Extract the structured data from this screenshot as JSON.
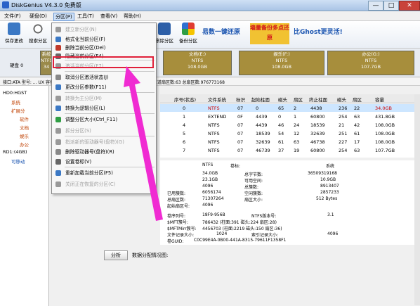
{
  "window": {
    "title": "DiskGenius V4.3.0 免费版",
    "min": "—",
    "max": "□",
    "close": "✕"
  },
  "menu": [
    "文件(F)",
    "硬盘(D)",
    "分区(P)",
    "工具(T)",
    "查看(V)",
    "帮助(H)"
  ],
  "toolbar": {
    "buttons": [
      "保存更改",
      "搜索分区",
      "删除分区",
      "备份分区"
    ],
    "banner1": "易数一键还原",
    "banner2": "墙量备份多点还原",
    "banner3": "比Ghost更灵活!"
  },
  "disk": {
    "label": "硬盘 0",
    "model_label": "型号",
    "partitions": [
      {
        "name": "系统",
        "fs": "NTFS",
        "size": "34",
        "color": "#9a8a4a"
      },
      {
        "name": "文档(E:)",
        "fs": "NTFS",
        "size": "108.0GB",
        "color": "#a78e3c"
      },
      {
        "name": "娱乐(F:)",
        "fs": "NTFS",
        "size": "108.0GB",
        "color": "#a78e3c"
      },
      {
        "name": "办公(G:)",
        "fs": "NTFS",
        "size": "107.7GB",
        "color": "#a78e3c"
      }
    ]
  },
  "infoline": "接口:ATA  型号:  ...  UX  容量:465.8GB(476940MB)  柱面数:60801  磁头数:255  每道扇区数:63  总扇区数:976773168",
  "tree": [
    "HD0:HGST",
    "系统",
    "扩展分",
    "软件",
    "文档",
    "娱乐",
    "办公",
    "RD1:(4GB)",
    "可移动"
  ],
  "context_menu": {
    "items": [
      {
        "label": "建立新分区(N)",
        "disabled": true
      },
      {
        "label": "格式化当前分区(F)",
        "disabled": false
      },
      {
        "label": "删除当前分区(Del)",
        "disabled": false
      },
      {
        "label": "隐藏当前分区(F4)",
        "disabled": false
      },
      {
        "label": "激活当前分区(F7)",
        "disabled": true
      },
      {
        "label": "取消分区激活状态(J)",
        "disabled": false
      },
      {
        "label": "更改分区参数(F11)",
        "disabled": false
      },
      {
        "label": "转换为主分区(M)",
        "disabled": true
      },
      {
        "label": "转换为逻辑分区(L)",
        "disabled": false
      },
      {
        "label": "调整分区大小(Ctrl_F11)",
        "disabled": false
      },
      {
        "label": "拆分分区(S)",
        "disabled": true
      },
      {
        "label": "指派新的驱动器号(盘符)(G)",
        "disabled": true
      },
      {
        "label": "删除驱动器号(盘符)(R)",
        "disabled": false
      },
      {
        "label": "设置卷标(V)",
        "disabled": false
      },
      {
        "label": "重新加载当前分区(F5)",
        "disabled": false
      },
      {
        "label": "关闭正在恢复的分区(C)",
        "disabled": true
      }
    ]
  },
  "table": {
    "headers": [
      "序号(状态)",
      "文件系统",
      "标识",
      "起始柱面",
      "磁头",
      "扇区",
      "终止柱面",
      "磁头",
      "扇区",
      "容量"
    ],
    "rows": [
      [
        "0",
        "NTFS",
        "07",
        "0",
        "65",
        "2",
        "4438",
        "236",
        "22",
        "34.0GB"
      ],
      [
        "1",
        "EXTEND",
        "0F",
        "4439",
        "0",
        "1",
        "60800",
        "254",
        "63",
        "431.8GB"
      ],
      [
        "4",
        "NTFS",
        "07",
        "4439",
        "46",
        "24",
        "18539",
        "21",
        "42",
        "108.0GB"
      ],
      [
        "5",
        "NTFS",
        "07",
        "18539",
        "54",
        "12",
        "32639",
        "251",
        "61",
        "108.0GB"
      ],
      [
        "6",
        "NTFS",
        "07",
        "32639",
        "61",
        "63",
        "46738",
        "227",
        "17",
        "108.0GB"
      ],
      [
        "7",
        "NTFS",
        "07",
        "46739",
        "37",
        "19",
        "60800",
        "254",
        "63",
        "107.7GB"
      ]
    ]
  },
  "detail": {
    "fs_label": "NTFS",
    "vol_label": "卷标:",
    "sys_label": "系统",
    "left_vals": [
      "34.0GB",
      "23.1GB",
      "4096",
      "6056174",
      "71307264",
      "4096"
    ],
    "left_keys": [
      "",
      "",
      "",
      "已用簇数:",
      "总扇区数:",
      "起始扇区号:"
    ],
    "mid_keys": [
      "总字节数:",
      "可用空间:",
      "总簇数:",
      "空闲簇数:",
      "扇区大小:"
    ],
    "right_vals": [
      "36509319168",
      "10.9GB",
      "8913407",
      "2857233",
      "512 Bytes"
    ],
    "serial_key": "卷序列号:",
    "serial_val": "18F9-956B",
    "ntfs_ver_key": "NTFS版本号:",
    "ntfs_ver_val": "3.1",
    "mft_key": "$MFT簇号:",
    "mft_val": "786432 (柱面:391 磁头:224 扇区:28)",
    "mftmirr_key": "$MFTMirr簇号:",
    "mftmirr_val": "4456703 (柱面:2219 磁头:150 扇区:36)",
    "rec_key": "文件记录大小:",
    "rec_val": "1024",
    "idx_key": "索引记录大小:",
    "idx_val": "4096",
    "guid_key": "卷GUID:",
    "guid_val": "C0C99E4A-0B00-441A-8315-79611F1358F1"
  },
  "bottom": {
    "analyze": "分析",
    "chart_label": "数据分配情况图:"
  }
}
